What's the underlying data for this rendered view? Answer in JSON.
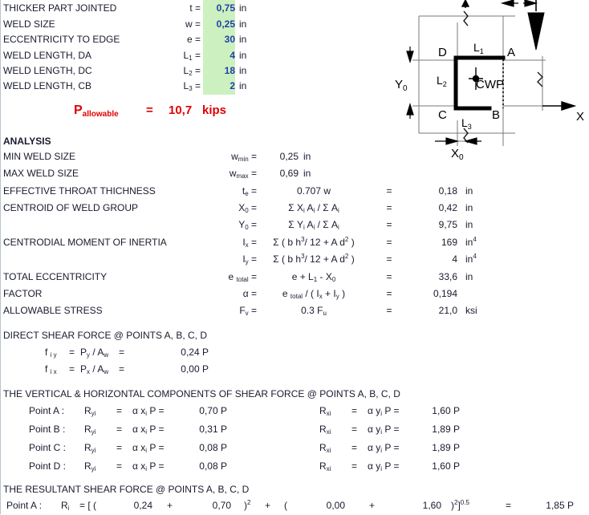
{
  "inputs": {
    "rows": [
      {
        "label": "THICKER PART JOINTED",
        "symbol": "t =",
        "value": "0,75",
        "unit": "in"
      },
      {
        "label": "WELD SIZE",
        "symbol": "w =",
        "value": "0,25",
        "unit": "in"
      },
      {
        "label": "ECCENTRICITY TO EDGE",
        "symbol": "e =",
        "value": "30",
        "unit": "in"
      },
      {
        "label": "WELD LENGTH, DA",
        "symbol": "L1 =",
        "value": "4",
        "unit": "in"
      },
      {
        "label": "WELD LENGTH, DC",
        "symbol": "L2 =",
        "value": "18",
        "unit": "in"
      },
      {
        "label": "WELD LENGTH, CB",
        "symbol": "L3 =",
        "value": "2",
        "unit": "in"
      }
    ]
  },
  "result": {
    "symbol": "P",
    "subscript": "allowable",
    "equals": "=",
    "value": "10,7",
    "unit": "kips"
  },
  "analysis": {
    "title": "ANALYSIS",
    "rows": [
      {
        "label": "MIN WELD SIZE",
        "sym": "w",
        "sub": "min",
        "formula": "",
        "eq": "",
        "value": "0,25",
        "unit": "in"
      },
      {
        "label": "MAX WELD SIZE",
        "sym": "w",
        "sub": "max",
        "formula": "",
        "eq": "",
        "value": "0,69",
        "unit": "in"
      },
      {
        "label": "EFFECTIVE THROAT THICHNESS",
        "sym": "t",
        "sub": "e",
        "formula": "0.707 w",
        "eq": "=",
        "value": "0,18",
        "unit": "in"
      },
      {
        "label": "CENTROID OF WELD GROUP",
        "sym": "X",
        "sub": "0",
        "formula": "Σ Xi Ai / Σ Ai",
        "eq": "=",
        "value": "0,42",
        "unit": "in"
      },
      {
        "label": "",
        "sym": "Y",
        "sub": "0",
        "formula": "Σ Yi Ai / Σ Ai",
        "eq": "=",
        "value": "9,75",
        "unit": "in"
      },
      {
        "label": "CENTRODIAL MOMENT OF INERTIA",
        "sym": "I",
        "sub": "x",
        "formula": "Σ ( b h3/ 12 + A d2 )",
        "eq": "=",
        "value": "169",
        "unit": "in4"
      },
      {
        "label": "",
        "sym": "I",
        "sub": "y",
        "formula": "Σ ( b h3/ 12 + A d2 )",
        "eq": "=",
        "value": "4",
        "unit": "in4"
      },
      {
        "label": "TOTAL ECCENTRICITY",
        "sym": "e",
        "sub": "total",
        "formula": "e + L1 - X0",
        "eq": "=",
        "value": "33,6",
        "unit": "in"
      },
      {
        "label": "FACTOR",
        "sym": "α",
        "sub": "",
        "formula": "e total / ( Ix + Iy )",
        "eq": "=",
        "value": "0,194",
        "unit": ""
      },
      {
        "label": "ALLOWABLE STRESS",
        "sym": "F",
        "sub": "v",
        "formula": "0.3 Fu",
        "eq": "=",
        "value": "21,0",
        "unit": "ksi"
      }
    ]
  },
  "direct_shear": {
    "title": "DIRECT SHEAR FORCE @ POINTS A, B, C, D",
    "rows": [
      {
        "sym": "f",
        "sub": "i y",
        "eq1": "=",
        "formula": "Py / Aw",
        "eq2": "=",
        "value": "0,24 P"
      },
      {
        "sym": "f",
        "sub": "i x",
        "eq1": "=",
        "formula": "Px / Aw",
        "eq2": "=",
        "value": "0,00 P"
      }
    ]
  },
  "components": {
    "title": "THE VERTICAL & HORIZONTAL COMPONENTS OF SHEAR FORCE @ POINTS A, B, C, D",
    "rows": [
      {
        "point": "Point A :",
        "lsym": "R",
        "lsub": "yi",
        "leq": "=",
        "lformula": "α xi P =",
        "lvalue": "0,70 P",
        "rsym": "R",
        "rsub": "xi",
        "req": "=",
        "rformula": "α yi P =",
        "rvalue": "1,60 P"
      },
      {
        "point": "Point B :",
        "lsym": "R",
        "lsub": "yi",
        "leq": "=",
        "lformula": "α xi P =",
        "lvalue": "0,31 P",
        "rsym": "R",
        "rsub": "xi",
        "req": "=",
        "rformula": "α yi P =",
        "rvalue": "1,89 P"
      },
      {
        "point": "Point C :",
        "lsym": "R",
        "lsub": "yi",
        "leq": "=",
        "lformula": "α xi P =",
        "lvalue": "0,08 P",
        "rsym": "R",
        "rsub": "xi",
        "req": "=",
        "rformula": "α yi P =",
        "rvalue": "1,89 P"
      },
      {
        "point": "Point D :",
        "lsym": "R",
        "lsub": "yi",
        "leq": "=",
        "lformula": "α xi P =",
        "lvalue": "0,08 P",
        "rsym": "R",
        "rsub": "xi",
        "req": "=",
        "rformula": "α yi P =",
        "rvalue": "1,60 P"
      }
    ]
  },
  "resultant": {
    "title": "THE RESULTANT SHEAR FORCE @ POINTS A, B, C, D",
    "row": {
      "point": "Point A :",
      "sym": "R",
      "sub": "i",
      "eq": "= [ (",
      "v1": "0,24",
      "plus1": "+",
      "v2": "0,70",
      "close1": ")",
      "pow1": "2",
      "plus2": "+",
      "open2": "(",
      "v3": "0,00",
      "plus3": "+",
      "v4": "1,60",
      "close2": ")",
      "pow2": "2",
      "bracket": "]",
      "pow3": "0.5",
      "eq2": "=",
      "value": "1,85 P"
    }
  },
  "diagram": {
    "labels": {
      "point_a": "A",
      "point_b": "B",
      "point_c": "C",
      "point_d": "D",
      "l1": "L1",
      "l2": "L2",
      "l3": "L3",
      "cwp": "CWP",
      "y0": "Y0",
      "x0": "X0",
      "x_axis": "X"
    }
  }
}
